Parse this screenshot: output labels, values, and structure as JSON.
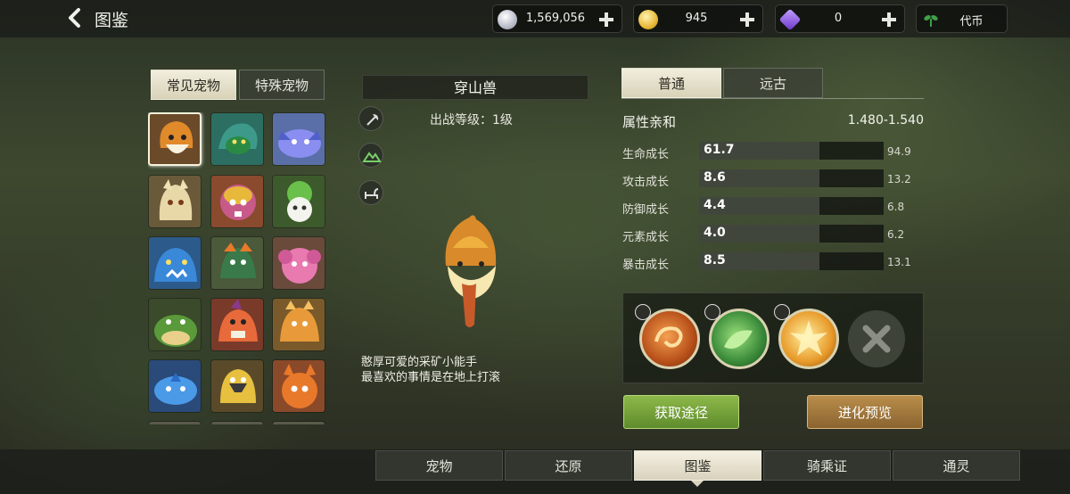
{
  "header": {
    "title": "图鉴",
    "back_icon": "chevron-left-icon"
  },
  "currencies": [
    {
      "icon": "silver-coin-icon",
      "value": "1,569,056",
      "color": "#c9ccd6"
    },
    {
      "icon": "gold-coin-icon",
      "value": "945",
      "color": "#e6b838"
    },
    {
      "icon": "purple-gem-icon",
      "value": "0",
      "color": "#8a5ad8"
    },
    {
      "icon": "leaf-icon",
      "value": "代币",
      "color": "#3fa047"
    }
  ],
  "category_tabs": {
    "common": "常见宠物",
    "special": "特殊宠物"
  },
  "pet": {
    "name": "穿山兽",
    "battle_level": "出战等级：1级",
    "desc_line1": "憨厚可爱的采矿小能手",
    "desc_line2": "最喜欢的事情是在地上打滚"
  },
  "mode_tabs": {
    "normal": "普通",
    "ancient": "远古"
  },
  "affinity": {
    "label": "属性亲和",
    "value": "1.480-1.540"
  },
  "stats": [
    {
      "label": "生命成长",
      "current": "61.7",
      "max": "94.9"
    },
    {
      "label": "攻击成长",
      "current": "8.6",
      "max": "13.2"
    },
    {
      "label": "防御成长",
      "current": "4.4",
      "max": "6.8"
    },
    {
      "label": "元素成长",
      "current": "4.0",
      "max": "6.2"
    },
    {
      "label": "暴击成长",
      "current": "8.5",
      "max": "13.1"
    }
  ],
  "buttons": {
    "obtain": "获取途径",
    "evolve": "进化预览"
  },
  "bottom_tabs": [
    "宠物",
    "还原",
    "图鉴",
    "骑乘证",
    "通灵"
  ]
}
